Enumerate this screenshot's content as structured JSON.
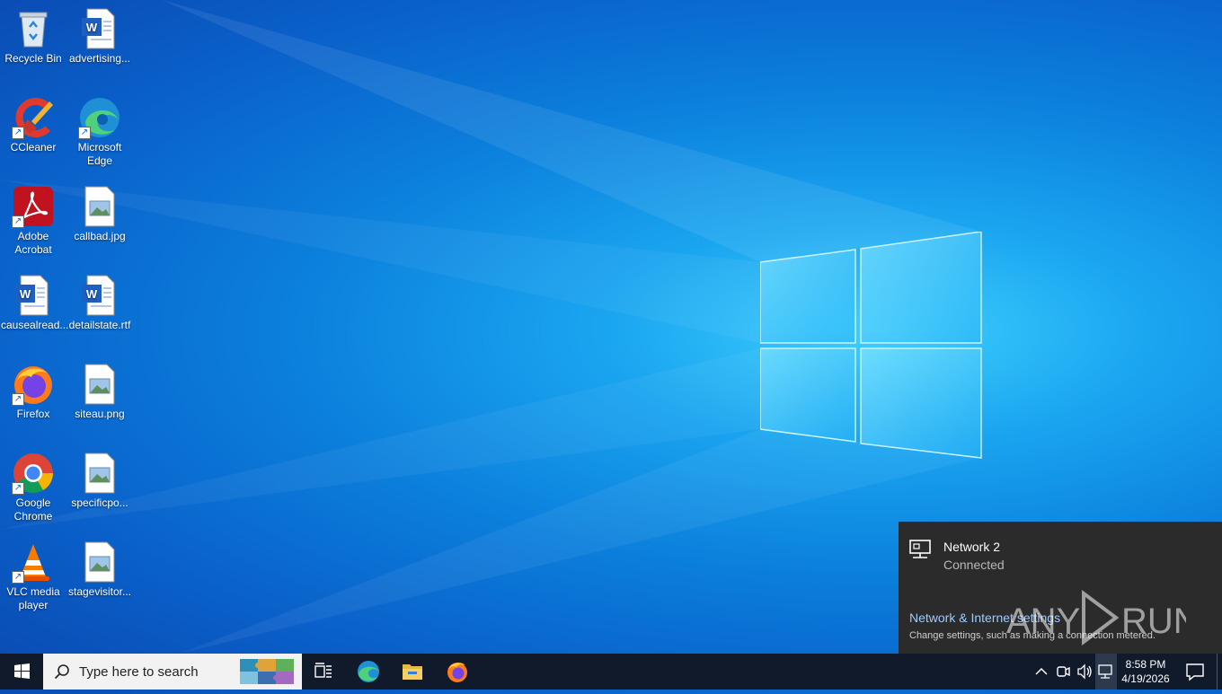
{
  "desktop": {
    "icons": [
      {
        "label": "Recycle Bin"
      },
      {
        "label": "advertising..."
      },
      {
        "label": "CCleaner"
      },
      {
        "label": "Microsoft Edge"
      },
      {
        "label": "Adobe Acrobat"
      },
      {
        "label": "callbad.jpg"
      },
      {
        "label": "causealread..."
      },
      {
        "label": "detailstate.rtf"
      },
      {
        "label": "Firefox"
      },
      {
        "label": "siteau.png"
      },
      {
        "label": "Google Chrome"
      },
      {
        "label": "specificpo..."
      },
      {
        "label": "VLC media player"
      },
      {
        "label": "stagevisitor..."
      }
    ]
  },
  "network_flyout": {
    "network_name": "Network 2",
    "status": "Connected",
    "settings_link": "Network & Internet settings",
    "settings_desc": "Change settings, such as making a connection metered."
  },
  "watermark": {
    "text": "ANY RUN"
  },
  "taskbar": {
    "search_placeholder": "Type here to search",
    "clock_time": "8:58 PM",
    "clock_date": "4/19/2026"
  },
  "colors": {
    "taskbar": "#101a2a",
    "flyout": "#2b2b2b",
    "link": "#9ecbff",
    "wallpaper_blue": "#0b7fdc"
  }
}
